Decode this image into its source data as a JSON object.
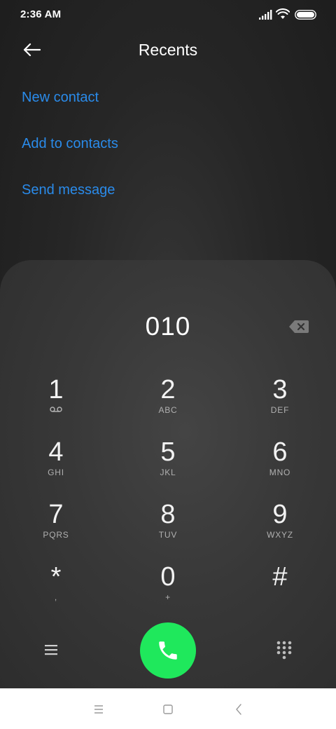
{
  "status_bar": {
    "time": "2:36 AM",
    "icons": [
      "signal-icon",
      "wifi-icon",
      "battery-icon"
    ]
  },
  "header": {
    "title": "Recents",
    "back_icon": "arrow-left-icon"
  },
  "actions": [
    {
      "label": "New contact"
    },
    {
      "label": "Add to contacts"
    },
    {
      "label": "Send message"
    }
  ],
  "dialpad": {
    "number": "010",
    "backspace_icon": "backspace-icon",
    "keys": [
      {
        "digit": "1",
        "letters": ""
      },
      {
        "digit": "2",
        "letters": "ABC"
      },
      {
        "digit": "3",
        "letters": "DEF"
      },
      {
        "digit": "4",
        "letters": "GHI"
      },
      {
        "digit": "5",
        "letters": "JKL"
      },
      {
        "digit": "6",
        "letters": "MNO"
      },
      {
        "digit": "7",
        "letters": "PQRS"
      },
      {
        "digit": "8",
        "letters": "TUV"
      },
      {
        "digit": "9",
        "letters": "WXYZ"
      },
      {
        "digit": "*",
        "letters": ","
      },
      {
        "digit": "0",
        "letters": "+"
      },
      {
        "digit": "#",
        "letters": ""
      }
    ],
    "key1_sub_icon": "voicemail-icon",
    "menu_icon": "menu-icon",
    "call_icon": "phone-icon",
    "keypad_icon": "dialpad-icon"
  },
  "nav_bar": {
    "icons": [
      "recent-apps-icon",
      "home-icon",
      "back-icon"
    ]
  },
  "colors": {
    "accent": "#2a8bea",
    "call": "#1fe85c",
    "background": "#262626"
  }
}
